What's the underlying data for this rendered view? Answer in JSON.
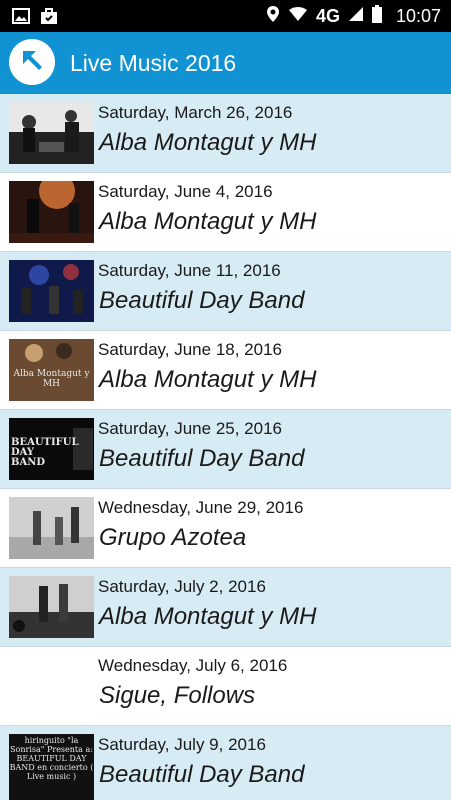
{
  "status_bar": {
    "network": "4G",
    "time": "10:07",
    "icons": [
      "gallery-icon",
      "briefcase-icon",
      "location-icon",
      "wifi-icon",
      "signal-icon",
      "battery-icon"
    ]
  },
  "app_bar": {
    "title": "Live Music 2016",
    "back_icon": "arrow-up-left-icon",
    "color": "#1192d2"
  },
  "events": [
    {
      "date": "Saturday, March 26, 2016",
      "name": "Alba Montagut y MH",
      "thumb_text": ""
    },
    {
      "date": "Saturday, June 4, 2016",
      "name": "Alba Montagut y MH",
      "thumb_text": ""
    },
    {
      "date": "Saturday, June 11, 2016",
      "name": "Beautiful Day Band",
      "thumb_text": ""
    },
    {
      "date": "Saturday, June 18, 2016",
      "name": "Alba Montagut y MH",
      "thumb_text": "Alba Montagut y MH"
    },
    {
      "date": "Saturday, June 25, 2016",
      "name": "Beautiful Day Band",
      "thumb_text": "BEAUTIFUL DAY BAND"
    },
    {
      "date": "Wednesday, June 29, 2016",
      "name": "Grupo Azotea",
      "thumb_text": ""
    },
    {
      "date": "Saturday, July 2, 2016",
      "name": "Alba Montagut y MH",
      "thumb_text": ""
    },
    {
      "date": "Wednesday, July 6, 2016",
      "name": "Sigue, Follows",
      "thumb_text": ""
    },
    {
      "date": "Saturday, July 9, 2016",
      "name": "Beautiful Day Band",
      "thumb_text": "hiringuito \"la Sonrisa\" Presenta a: BEAUTIFUL DAY BAND en concierto ( Live music )"
    }
  ],
  "colors": {
    "row_alt": "#d7ebf4",
    "row_plain": "#ffffff"
  }
}
